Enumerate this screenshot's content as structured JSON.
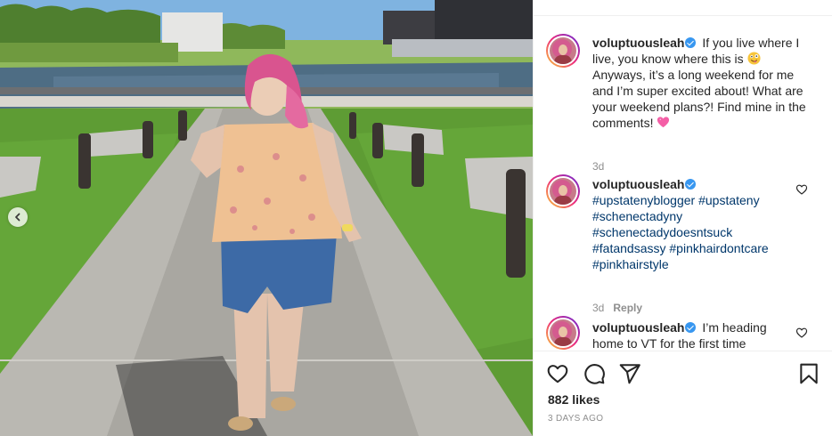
{
  "post": {
    "username": "voluptuousleah",
    "comments": [
      {
        "username": "voluptuousleah",
        "text_part1": "If you live where I live, you know where this is",
        "emoji1": "zany-face-emoji",
        "text_part2": "Anyways, it’s a long weekend for me and I’m super excited about! What are your weekend plans?! Find mine in the comments!",
        "emoji2": "heart-emoji",
        "time": "3d"
      },
      {
        "username": "voluptuousleah",
        "hashtags": [
          "#upstatenyblogger",
          "#upstateny",
          "#schenectadyny",
          "#schenectadydoesntsuck",
          "#fatandsassy",
          "#pinkhairdontcare",
          "#pinkhairstyle"
        ],
        "time": "3d",
        "reply": "Reply"
      },
      {
        "username": "voluptuousleah",
        "text": "I’m heading home to VT for the first time"
      }
    ],
    "likes": "882 likes",
    "date": "3 DAYS AGO"
  },
  "icons": {
    "prev": "chevron-left-icon",
    "like": "heart-icon",
    "comment": "comment-icon",
    "share": "paper-plane-icon",
    "save": "bookmark-icon"
  },
  "colors": {
    "hashtag": "#00376b",
    "verified": "#3897f0",
    "muted": "#8e8e8e",
    "text": "#262626"
  }
}
